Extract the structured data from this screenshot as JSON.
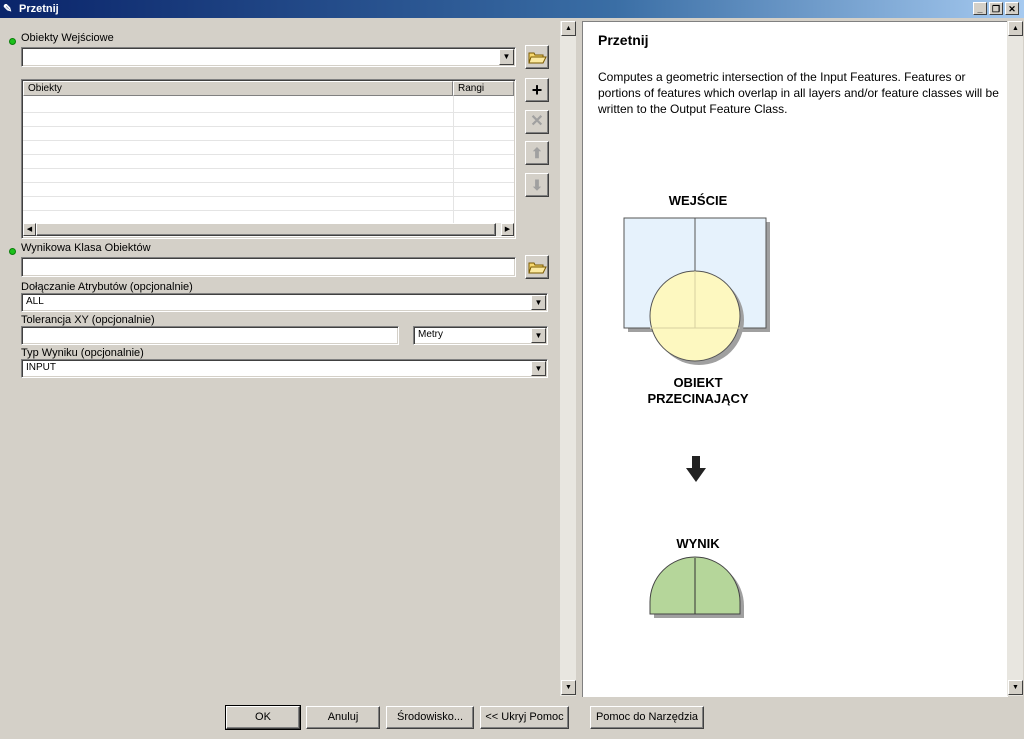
{
  "window": {
    "title": "Przetnij"
  },
  "form": {
    "input_features_label": "Obiekty Wejściowe",
    "table": {
      "col_features": "Obiekty",
      "col_ranks": "Rangi"
    },
    "output_label": "Wynikowa Klasa Obiektów",
    "join_attributes_label": "Dołączanie Atrybutów (opcjonalnie)",
    "join_attributes_value": "ALL",
    "xy_tolerance_label": "Tolerancja XY (opcjonalnie)",
    "xy_tolerance_value": "",
    "xy_units_value": "Metry",
    "output_type_label": "Typ Wyniku (opcjonalnie)",
    "output_type_value": "INPUT"
  },
  "help": {
    "title": "Przetnij",
    "description": "Computes a geometric intersection of the Input Features. Features or portions of features which overlap in all layers and/or feature classes will be written to the Output Feature Class.",
    "diagram": {
      "input_label": "WEJŚCIE",
      "intersect_label_1": "OBIEKT",
      "intersect_label_2": "PRZECINAJĄCY",
      "output_label": "WYNIK"
    }
  },
  "buttons": {
    "ok": "OK",
    "cancel": "Anuluj",
    "environments": "Środowisko...",
    "hide_help": "<< Ukryj Pomoc",
    "tool_help": "Pomoc do Narzędzia"
  },
  "colors": {
    "input_fill": "#e6f2fc",
    "intersect_fill": "#fdf8c0",
    "output_fill": "#b5d69a",
    "required_dot": "#1cc11c"
  }
}
